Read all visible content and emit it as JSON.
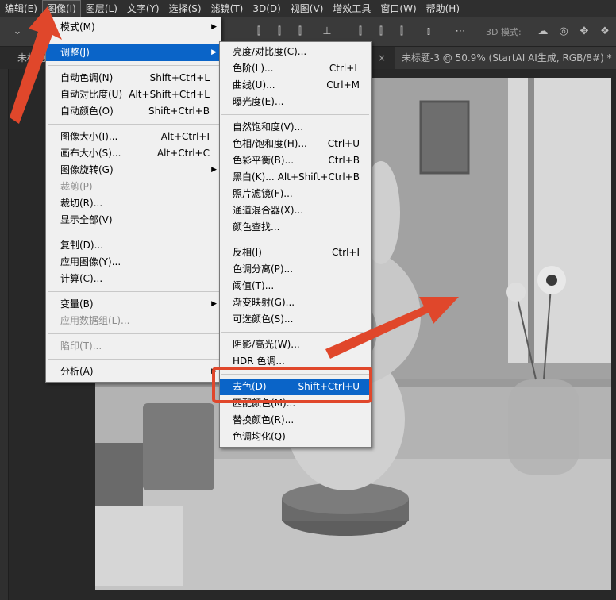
{
  "menubar": {
    "items": [
      "编辑(E)",
      "图像(I)",
      "图层(L)",
      "文字(Y)",
      "选择(S)",
      "滤镜(T)",
      "3D(D)",
      "视图(V)",
      "增效工具",
      "窗口(W)",
      "帮助(H)"
    ]
  },
  "options": {
    "mode_label": "3D 模式:"
  },
  "tabs": {
    "tab1": "未标题",
    "tab3": "未标题-3 @ 50.9% (StartAI AI生成, RGB/8#) *",
    "close": "×"
  },
  "image_menu": [
    {
      "label": "模式(M)",
      "shortcut": "",
      "submenu": true
    },
    {
      "sep": true
    },
    {
      "label": "调整(J)",
      "shortcut": "",
      "submenu": true,
      "highlight": true
    },
    {
      "sep": true
    },
    {
      "label": "自动色调(N)",
      "shortcut": "Shift+Ctrl+L"
    },
    {
      "label": "自动对比度(U)",
      "shortcut": "Alt+Shift+Ctrl+L"
    },
    {
      "label": "自动颜色(O)",
      "shortcut": "Shift+Ctrl+B"
    },
    {
      "sep": true
    },
    {
      "label": "图像大小(I)...",
      "shortcut": "Alt+Ctrl+I"
    },
    {
      "label": "画布大小(S)...",
      "shortcut": "Alt+Ctrl+C"
    },
    {
      "label": "图像旋转(G)",
      "shortcut": "",
      "submenu": true
    },
    {
      "label": "裁剪(P)",
      "shortcut": "",
      "disabled": true
    },
    {
      "label": "裁切(R)...",
      "shortcut": ""
    },
    {
      "label": "显示全部(V)",
      "shortcut": ""
    },
    {
      "sep": true
    },
    {
      "label": "复制(D)...",
      "shortcut": ""
    },
    {
      "label": "应用图像(Y)...",
      "shortcut": ""
    },
    {
      "label": "计算(C)...",
      "shortcut": ""
    },
    {
      "sep": true
    },
    {
      "label": "变量(B)",
      "shortcut": "",
      "submenu": true
    },
    {
      "label": "应用数据组(L)...",
      "shortcut": "",
      "disabled": true
    },
    {
      "sep": true
    },
    {
      "label": "陷印(T)...",
      "shortcut": "",
      "disabled": true
    },
    {
      "sep": true
    },
    {
      "label": "分析(A)",
      "shortcut": "",
      "submenu": true
    }
  ],
  "adjust_menu": [
    {
      "label": "亮度/对比度(C)...",
      "shortcut": ""
    },
    {
      "label": "色阶(L)...",
      "shortcut": "Ctrl+L"
    },
    {
      "label": "曲线(U)...",
      "shortcut": "Ctrl+M"
    },
    {
      "label": "曝光度(E)...",
      "shortcut": ""
    },
    {
      "sep": true
    },
    {
      "label": "自然饱和度(V)...",
      "shortcut": ""
    },
    {
      "label": "色相/饱和度(H)...",
      "shortcut": "Ctrl+U"
    },
    {
      "label": "色彩平衡(B)...",
      "shortcut": "Ctrl+B"
    },
    {
      "label": "黑白(K)...",
      "shortcut": "Alt+Shift+Ctrl+B"
    },
    {
      "label": "照片滤镜(F)...",
      "shortcut": ""
    },
    {
      "label": "通道混合器(X)...",
      "shortcut": ""
    },
    {
      "label": "颜色查找...",
      "shortcut": ""
    },
    {
      "sep": true
    },
    {
      "label": "反相(I)",
      "shortcut": "Ctrl+I"
    },
    {
      "label": "色调分离(P)...",
      "shortcut": ""
    },
    {
      "label": "阈值(T)...",
      "shortcut": ""
    },
    {
      "label": "渐变映射(G)...",
      "shortcut": ""
    },
    {
      "label": "可选颜色(S)...",
      "shortcut": ""
    },
    {
      "sep": true
    },
    {
      "label": "阴影/高光(W)...",
      "shortcut": ""
    },
    {
      "label": "HDR 色调...",
      "shortcut": ""
    },
    {
      "sep": true
    },
    {
      "label": "去色(D)",
      "shortcut": "Shift+Ctrl+U",
      "highlight": true
    },
    {
      "label": "匹配颜色(M)...",
      "shortcut": ""
    },
    {
      "label": "替换颜色(R)...",
      "shortcut": ""
    },
    {
      "label": "色调均化(Q)",
      "shortcut": ""
    }
  ],
  "colors": {
    "annotation": "#e0472b",
    "highlight": "#0a64c8"
  }
}
